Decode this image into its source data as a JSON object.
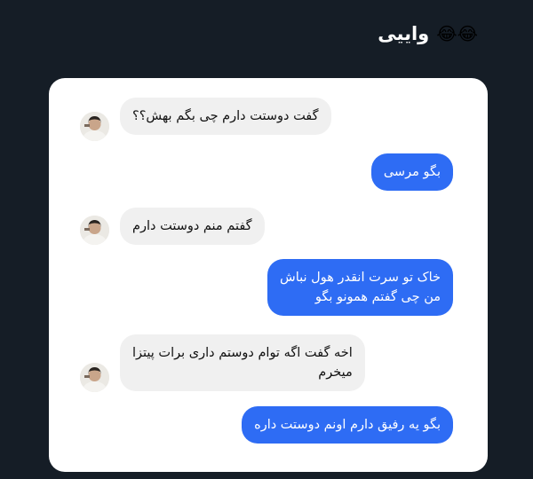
{
  "post": {
    "title": "واییی",
    "emoji": "😂😂"
  },
  "chat": {
    "messages": [
      {
        "direction": "received",
        "lines": [
          "گفت دوستت دارم چی بگم بهش؟؟"
        ]
      },
      {
        "direction": "sent",
        "lines": [
          "بگو مرسی"
        ]
      },
      {
        "direction": "received",
        "lines": [
          "گفتم منم دوستت دارم"
        ]
      },
      {
        "direction": "sent",
        "lines": [
          "خاک تو سرت انقدر هول نباش",
          "من چی گفتم همونو بگو"
        ]
      },
      {
        "direction": "received",
        "lines": [
          "اخه گفت اگه توام دوستم داری برات پیتزا",
          "میخرم"
        ]
      },
      {
        "direction": "sent",
        "lines": [
          "بگو یه رفیق دارم اونم دوستت داره"
        ]
      }
    ]
  },
  "colors": {
    "background": "#151d26",
    "sent_bubble": "#2e6cf4",
    "received_bubble": "#f0f0f0"
  }
}
